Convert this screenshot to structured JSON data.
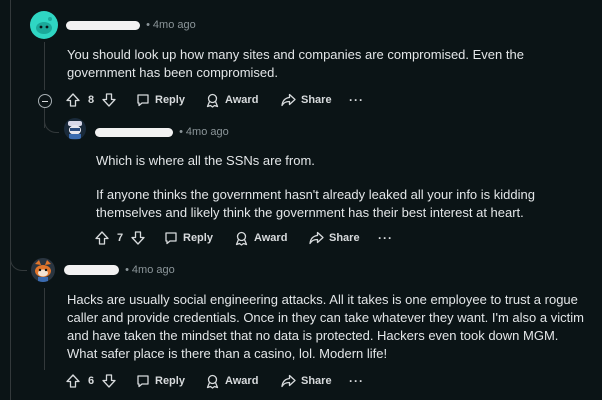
{
  "comments": [
    {
      "time": "4mo ago",
      "body": [
        "You should look up how many sites and companies are compromised. Even the government has been compromised."
      ],
      "votes": "8",
      "reply_label": "Reply",
      "award_label": "Award",
      "share_label": "Share",
      "more_label": "···"
    },
    {
      "time": "4mo ago",
      "body": [
        "Which is where all the SSNs are from.",
        "If anyone thinks the government hasn't already leaked all your info is kidding themselves and likely think the government has their best interest at heart."
      ],
      "votes": "7",
      "reply_label": "Reply",
      "award_label": "Award",
      "share_label": "Share",
      "more_label": "···"
    },
    {
      "time": "4mo ago",
      "body": [
        "Hacks are usually social engineering attacks. All it takes is one employee to trust a rogue caller and provide credentials. Once in they can take whatever they want. I'm also a victim and have taken the mindset that no data is protected. Hackers even took down MGM. What safer place is there than a casino, lol. Modern life!"
      ],
      "votes": "6",
      "reply_label": "Reply",
      "award_label": "Award",
      "share_label": "Share",
      "more_label": "···"
    }
  ],
  "colors": {
    "background": "#0b1416",
    "text": "#e3e6e8",
    "meta": "#8b9599",
    "thread_line": "#33393b",
    "avatar1": "#2fd6c3"
  },
  "icons": [
    "upvote-icon",
    "downvote-icon",
    "comment-icon",
    "award-icon",
    "share-icon",
    "collapse-icon"
  ]
}
